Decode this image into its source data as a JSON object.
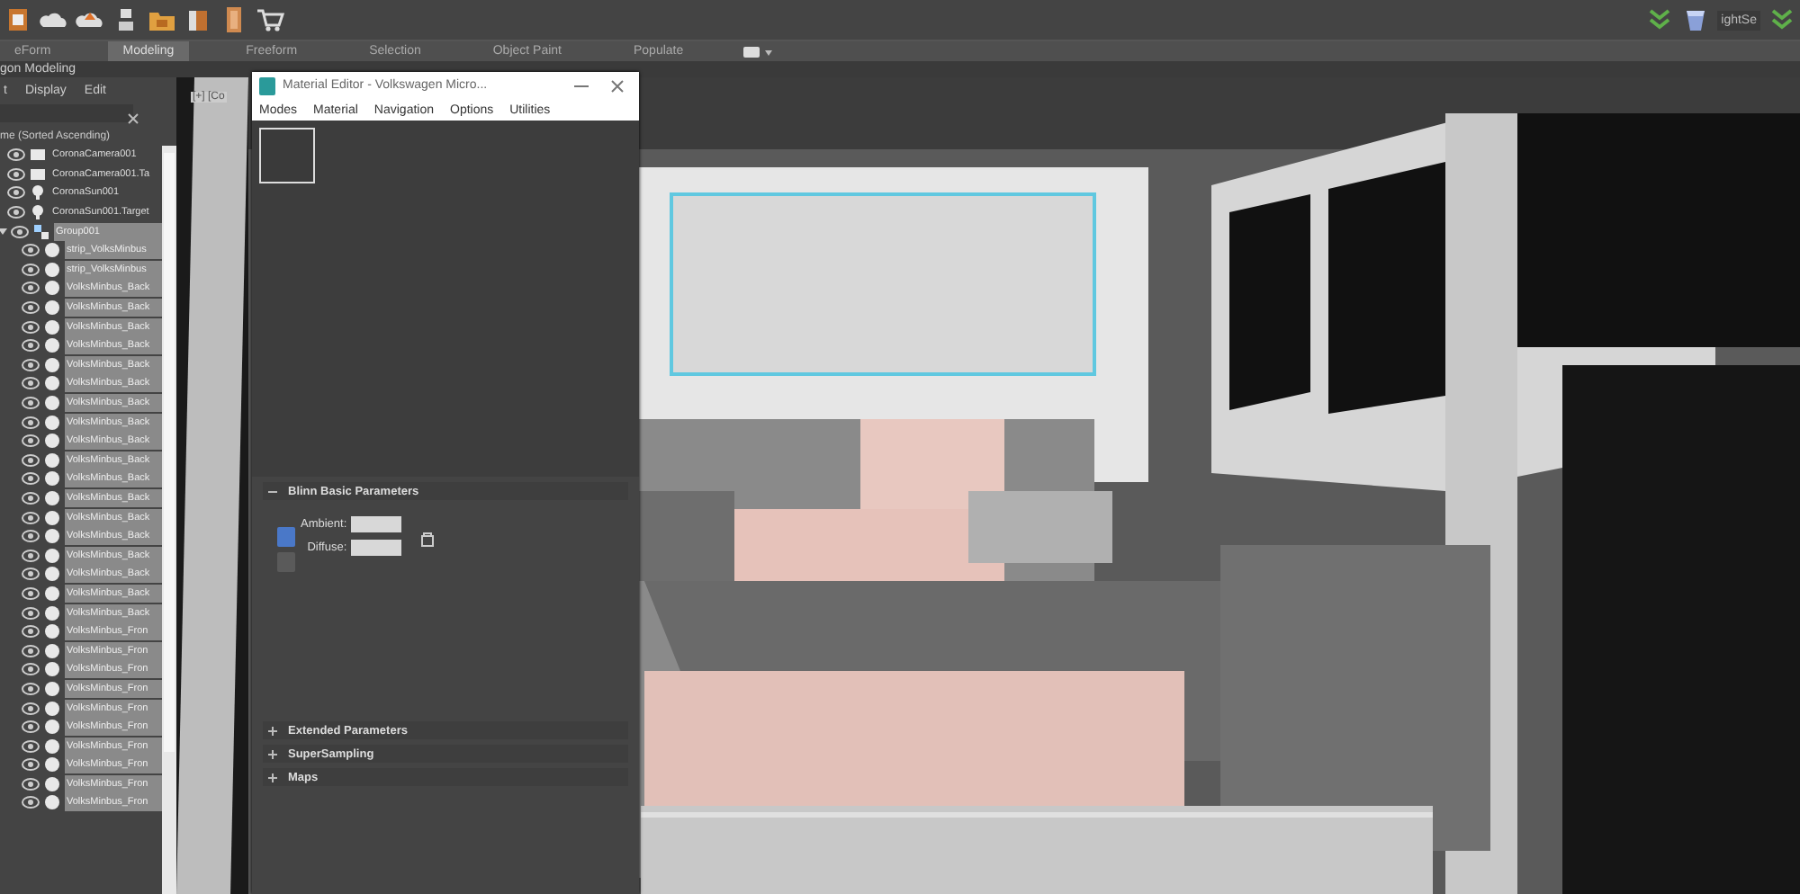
{
  "toolbar": {
    "right_label": "ightSe"
  },
  "ribbon": {
    "tabs": [
      {
        "label": "eForm",
        "selected": false
      },
      {
        "label": "Modeling",
        "selected": true
      },
      {
        "label": "Freeform",
        "selected": false
      },
      {
        "label": "Selection",
        "selected": false
      },
      {
        "label": "Object Paint",
        "selected": false
      },
      {
        "label": "Populate",
        "selected": false
      }
    ],
    "panel_title": "gon Modeling"
  },
  "scene_explorer": {
    "menu": [
      "t",
      "Display",
      "Edit"
    ],
    "column_header": "me (Sorted Ascending)",
    "items": [
      {
        "name": "CoronaCamera001",
        "kind": "camera",
        "selected": false
      },
      {
        "name": "CoronaCamera001.Ta",
        "kind": "camera",
        "selected": false
      },
      {
        "name": "CoronaSun001",
        "kind": "light",
        "selected": false
      },
      {
        "name": "CoronaSun001.Target",
        "kind": "light",
        "selected": false
      },
      {
        "name": "Group001",
        "kind": "group",
        "selected": true,
        "expanded": true,
        "children": [
          {
            "name": "strip_VolksMinbus",
            "kind": "object",
            "selected": true
          },
          {
            "name": "strip_VolksMinbus",
            "kind": "object",
            "selected": true
          },
          {
            "name": "VolksMinbus_Back",
            "kind": "object",
            "selected": true
          },
          {
            "name": "VolksMinbus_Back",
            "kind": "object",
            "selected": true
          },
          {
            "name": "VolksMinbus_Back",
            "kind": "object",
            "selected": true
          },
          {
            "name": "VolksMinbus_Back",
            "kind": "object",
            "selected": true
          },
          {
            "name": "VolksMinbus_Back",
            "kind": "object",
            "selected": true
          },
          {
            "name": "VolksMinbus_Back",
            "kind": "object",
            "selected": true
          },
          {
            "name": "VolksMinbus_Back",
            "kind": "object",
            "selected": true
          },
          {
            "name": "VolksMinbus_Back",
            "kind": "object",
            "selected": true
          },
          {
            "name": "VolksMinbus_Back",
            "kind": "object",
            "selected": true
          },
          {
            "name": "VolksMinbus_Back",
            "kind": "object",
            "selected": true
          },
          {
            "name": "VolksMinbus_Back",
            "kind": "object",
            "selected": true
          },
          {
            "name": "VolksMinbus_Back",
            "kind": "object",
            "selected": true
          },
          {
            "name": "VolksMinbus_Back",
            "kind": "object",
            "selected": true
          },
          {
            "name": "VolksMinbus_Back",
            "kind": "object",
            "selected": true
          },
          {
            "name": "VolksMinbus_Back",
            "kind": "object",
            "selected": true
          },
          {
            "name": "VolksMinbus_Back",
            "kind": "object",
            "selected": true
          },
          {
            "name": "VolksMinbus_Back",
            "kind": "object",
            "selected": true
          },
          {
            "name": "VolksMinbus_Back",
            "kind": "object",
            "selected": true
          },
          {
            "name": "VolksMinbus_Fron",
            "kind": "object",
            "selected": true
          },
          {
            "name": "VolksMinbus_Fron",
            "kind": "object",
            "selected": true
          },
          {
            "name": "VolksMinbus_Fron",
            "kind": "object",
            "selected": true
          },
          {
            "name": "VolksMinbus_Fron",
            "kind": "object",
            "selected": true
          },
          {
            "name": "VolksMinbus_Fron",
            "kind": "object",
            "selected": true
          },
          {
            "name": "VolksMinbus_Fron",
            "kind": "object",
            "selected": true
          },
          {
            "name": "VolksMinbus_Fron",
            "kind": "object",
            "selected": true
          },
          {
            "name": "VolksMinbus_Fron",
            "kind": "object",
            "selected": true
          },
          {
            "name": "VolksMinbus_Fron",
            "kind": "object",
            "selected": true
          },
          {
            "name": "VolksMinbus_Fron",
            "kind": "object",
            "selected": true
          }
        ]
      }
    ]
  },
  "viewport": {
    "label": "[+] [Co"
  },
  "material_editor": {
    "title": "Material Editor - Volkswagen Micro...",
    "menu": [
      "Modes",
      "Material",
      "Navigation",
      "Options",
      "Utilities"
    ],
    "rollouts": [
      {
        "title": "Blinn Basic Parameters",
        "expanded": true,
        "fields": [
          "Ambient:",
          "Diffuse:"
        ]
      },
      {
        "title": "Extended Parameters",
        "expanded": false
      },
      {
        "title": "SuperSampling",
        "expanded": false
      },
      {
        "title": "Maps",
        "expanded": false
      }
    ]
  }
}
